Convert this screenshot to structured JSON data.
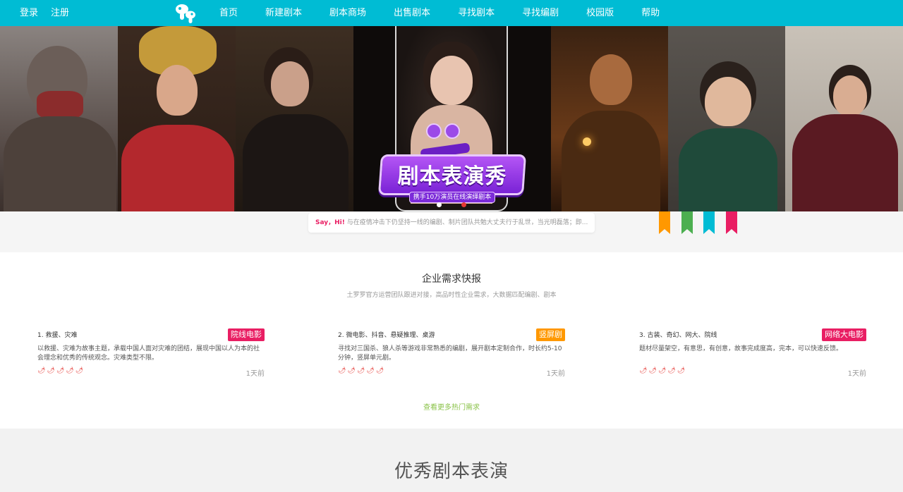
{
  "nav": {
    "login": "登录",
    "register": "注册",
    "logo_icon": "mushroom-logo-icon",
    "menu": [
      "首页",
      "新建剧本",
      "剧本商场",
      "出售剧本",
      "寻找剧本",
      "寻找编剧",
      "校园版",
      "帮助"
    ],
    "bg_color": "#00bcd4"
  },
  "banner": {
    "promo_title": "剧本表演秀",
    "promo_subtitle": "携手10万演员在线演绎剧本",
    "carousel_dots": 2,
    "active_dot": 2
  },
  "sayhi": {
    "label": "Say，Hi!",
    "text": "与在疫情冲击下仍坚持一线的编剧、制片团队共勉大丈夫行于乱世，当光明磊落；即..."
  },
  "ribbons": {
    "colors": [
      "#ff9800",
      "#4caf50",
      "#00bcd4",
      "#e91e63"
    ]
  },
  "demands": {
    "title": "企业需求快报",
    "subtitle": "土罗罗官方运营团队跟进对接，高品时性企业需求，大数据匹配编剧、剧本",
    "items": [
      {
        "title": "1. 救援、灾难",
        "tag": "院线电影",
        "tag_color": "#e91e63",
        "desc": "以救援、灾难为故事主题，承载中国人面对灾难的团结，展现中国以人为本的社会理念和优秀的传统观念。灾难类型不限。",
        "peppers": "🌶🌶🌶🌶🌶",
        "time": "1天前"
      },
      {
        "title": "2. 微电影、抖音、悬疑推理、桌游",
        "tag": "竖屏剧",
        "tag_color": "#ff9800",
        "desc": "寻找对三国杀、狼人杀等游戏非常熟悉的编剧，展开剧本定制合作，时长约5-10分钟，竖屏单元剧。",
        "peppers": "🌶🌶🌶🌶🌶",
        "time": "1天前"
      },
      {
        "title": "3. 古装、奇幻、网大、院线",
        "tag": "网络大电影",
        "tag_color": "#e91e63",
        "desc": "题材尽量架空，有意思，有创意，故事完成度高，完本，可以快速反馈。",
        "peppers": "🌶🌶🌶🌶🌶",
        "time": "1天前"
      }
    ],
    "more": "查看更多热门需求"
  },
  "showcase": {
    "title": "优秀剧本表演"
  }
}
